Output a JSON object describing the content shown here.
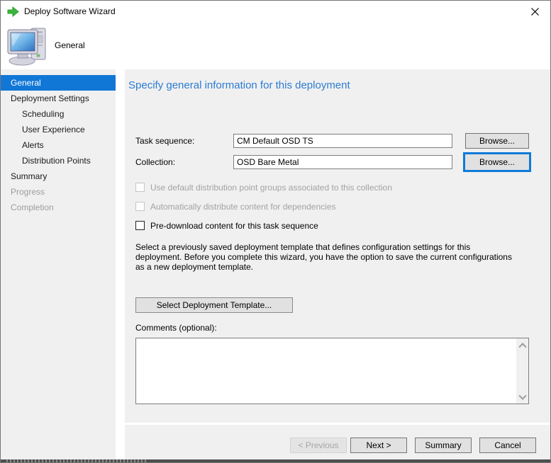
{
  "window": {
    "title": "Deploy Software Wizard"
  },
  "header": {
    "step_title": "General"
  },
  "sidebar": {
    "items": [
      {
        "label": "General",
        "state": "selected",
        "indent": false
      },
      {
        "label": "Deployment Settings",
        "state": "enabled",
        "indent": false
      },
      {
        "label": "Scheduling",
        "state": "enabled",
        "indent": true
      },
      {
        "label": "User Experience",
        "state": "enabled",
        "indent": true
      },
      {
        "label": "Alerts",
        "state": "enabled",
        "indent": true
      },
      {
        "label": "Distribution Points",
        "state": "enabled",
        "indent": true
      },
      {
        "label": "Summary",
        "state": "enabled",
        "indent": false
      },
      {
        "label": "Progress",
        "state": "disabled",
        "indent": false
      },
      {
        "label": "Completion",
        "state": "disabled",
        "indent": false
      }
    ]
  },
  "content": {
    "heading": "Specify general information for this deployment",
    "fields": [
      {
        "label": "Task sequence:",
        "value": "CM Default OSD TS",
        "button_label": "Browse...",
        "focused": false
      },
      {
        "label": "Collection:",
        "value": "OSD Bare Metal",
        "button_label": "Browse...",
        "focused": true
      }
    ],
    "checkboxes": [
      {
        "label": "Use default distribution point groups associated to this collection",
        "checked": false,
        "disabled": true
      },
      {
        "label": "Automatically distribute content for dependencies",
        "checked": false,
        "disabled": true
      },
      {
        "label": "Pre-download content for this task sequence",
        "checked": false,
        "disabled": false
      }
    ],
    "template_text": "Select a previously saved deployment template that defines configuration settings for this deployment. Before you complete this wizard, you have the option to save the current configurations as a new deployment template.",
    "template_button_label": "Select Deployment Template...",
    "comments_label": "Comments (optional):",
    "comments_value": ""
  },
  "footer": {
    "buttons": [
      {
        "label": "< Previous",
        "disabled": true
      },
      {
        "label": "Next >",
        "disabled": false
      },
      {
        "label": "Summary",
        "disabled": false
      },
      {
        "label": "Cancel",
        "disabled": false
      }
    ]
  },
  "colors": {
    "accent_blue": "#1177d7",
    "heading_blue": "#2b7cd3",
    "focus_border": "#0f7ad8",
    "arrow_green": "#3cb43c"
  }
}
